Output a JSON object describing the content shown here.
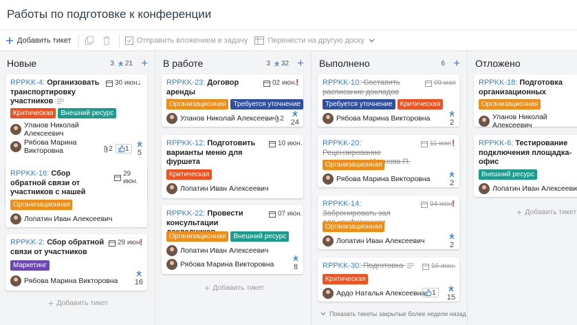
{
  "page": {
    "title": "Работы по подготовке к конференции"
  },
  "toolbar": {
    "add_ticket": "Добавить тикет",
    "send_attachment": "Отправить вложением в задачу",
    "move_board": "Перенести на другую доску"
  },
  "colors": {
    "critical": "#f0511f",
    "external": "#1b9c8c",
    "org": "#f08c18",
    "clarify": "#2f4fa3",
    "marketing": "#6a47b8",
    "accent": "#3b7dd8"
  },
  "columns": [
    {
      "title": "Новые",
      "count": "3",
      "points": "21",
      "add_label": "Добавить тикет",
      "cards": [
        {
          "key": "RPPKK-4:",
          "title": "Организовать транспортировку участников",
          "due": "30 июн.",
          "tags": [
            "Критическая",
            "Внешний ресурс"
          ],
          "people": [
            "Уланов Николай Алексеевич",
            "Рябова Марина Викторовна"
          ],
          "attachments": "2",
          "likes": "1",
          "points": "5"
        },
        {
          "key": "RPPKK-16:",
          "title": "Сбор обратной связи от участников с нашей стороны",
          "due": "29 июн.",
          "tags": [
            "Организационная"
          ],
          "people": [
            "Лопатин Иван Алексеевич"
          ]
        },
        {
          "key": "RPPKK-2:",
          "title": "Сбор обратной связи от участников",
          "due": "29 июн.",
          "tags": [
            "Маркетинг"
          ],
          "people": [
            "Рябова Марина Викторовна"
          ],
          "points": "16"
        }
      ]
    },
    {
      "title": "В работе",
      "count": "3",
      "points": "32",
      "add_label": "Добавить тикет",
      "cards": [
        {
          "key": "RPPKK-23:",
          "title": "Договор аренды",
          "due": "02 июн.",
          "tags": [
            "Организационная",
            "Требуется уточнение"
          ],
          "people": [
            "Уланов Николай Алексеевич"
          ],
          "attachments": "2",
          "points": "24"
        },
        {
          "key": "RPPKK-12:",
          "title": "Подготовить варианты меню для фуршета",
          "due": "10 июн.",
          "tags": [
            "Критическая"
          ],
          "people": [
            "Лопатин Иван Алексеевич"
          ]
        },
        {
          "key": "RPPKK-22:",
          "title": "Провести консультации докладчиков",
          "due": "07 июн.",
          "tags": [
            "Организационная",
            "Внешний ресурс"
          ],
          "people": [
            "Лопатин Иван Алексеевич",
            "Рябова Марина Викторовна"
          ],
          "points": "8"
        }
      ]
    },
    {
      "title": "Выполнено",
      "count": "6",
      "add_label": "Показать тикеты закрытые более недели назад",
      "cards": [
        {
          "key": "RPPKK-10:",
          "title": "Составить расписание докладов",
          "due": "09 мая",
          "tags": [
            "Требуется уточнение",
            "Критическая"
          ],
          "people": [
            "Рябова Марина Викторовна"
          ],
          "points": "2"
        },
        {
          "key": "RPPKK-20:",
          "title": "Рецензирование выступления Иванова П.",
          "due": "11 мая",
          "tags": [
            "Организационная"
          ],
          "people": [
            "Рябова Марина Викторовна"
          ],
          "points": "2"
        },
        {
          "key": "RPPKK-14:",
          "title": "Забронировать зал для конференции",
          "due": "04 июн.",
          "tags": [
            "Организационная"
          ],
          "people": [
            "Лопатин Иван Алексеевич"
          ],
          "points": "2"
        },
        {
          "key": "RPPKK-30:",
          "title": "Подготовка",
          "due": "16 июн.",
          "tags": [
            "Критическая"
          ],
          "people": [
            "Ардо Наталья Алексеевна"
          ],
          "likes": "1",
          "points": "15"
        }
      ]
    },
    {
      "title": "Отложено",
      "add_label": "Добавить тикет",
      "cards": [
        {
          "key": "RPPKK-18:",
          "title": "Подготовка организационных документов",
          "tags": [
            "Организационная"
          ],
          "people": [
            "Уланов Николай Алексеевич"
          ]
        },
        {
          "key": "RPPKK-6:",
          "title": "Тестирование подключения площадка-офис",
          "tags": [
            "Внешний ресурс"
          ],
          "people": [
            "Лопатин Иван Алексеевич"
          ]
        }
      ]
    }
  ]
}
